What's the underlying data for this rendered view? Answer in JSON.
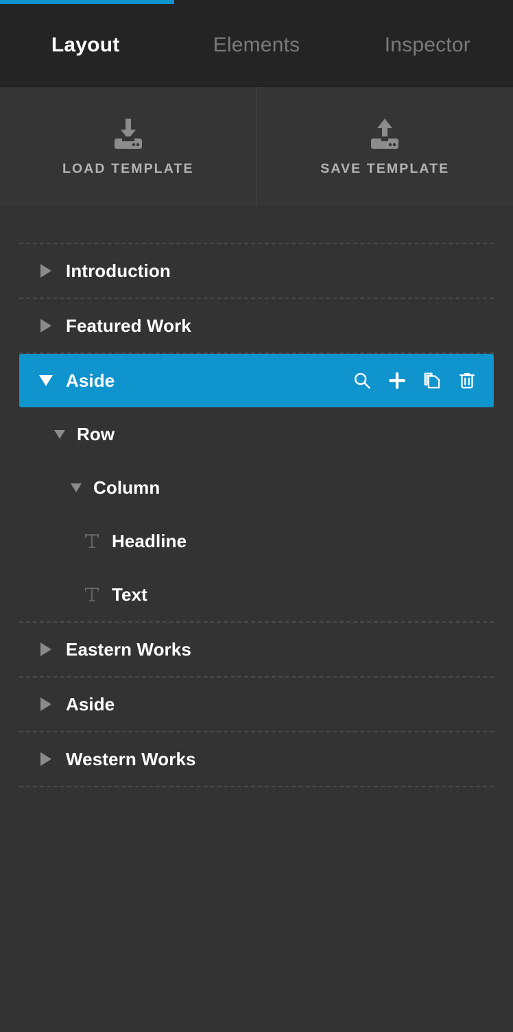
{
  "progress": {
    "percent": 34,
    "color": "#1094ce"
  },
  "tabs": [
    {
      "label": "Layout",
      "active": true
    },
    {
      "label": "Elements",
      "active": false
    },
    {
      "label": "Inspector",
      "active": false
    }
  ],
  "toolbar": {
    "load_label": "LOAD TEMPLATE",
    "load_icon": "download-icon",
    "save_label": "SAVE TEMPLATE",
    "save_icon": "upload-icon"
  },
  "tree": {
    "selected_actions": [
      {
        "name": "search-icon",
        "label": "Search"
      },
      {
        "name": "plus-icon",
        "label": "Add"
      },
      {
        "name": "duplicate-icon",
        "label": "Duplicate"
      },
      {
        "name": "trash-icon",
        "label": "Delete"
      }
    ],
    "items": [
      {
        "label": "Introduction",
        "level": 0,
        "state": "collapsed",
        "icon": "caret-right-icon",
        "selected": false
      },
      {
        "label": "Featured Work",
        "level": 0,
        "state": "collapsed",
        "icon": "caret-right-icon",
        "selected": false
      },
      {
        "label": "Aside",
        "level": 0,
        "state": "expanded",
        "icon": "caret-down-icon",
        "selected": true
      },
      {
        "label": "Row",
        "level": 1,
        "state": "expanded",
        "icon": "caret-down-icon",
        "selected": false
      },
      {
        "label": "Column",
        "level": 2,
        "state": "expanded",
        "icon": "caret-down-icon",
        "selected": false
      },
      {
        "label": "Headline",
        "level": 3,
        "state": "leaf",
        "icon": "text-type-icon",
        "selected": false
      },
      {
        "label": "Text",
        "level": 3,
        "state": "leaf",
        "icon": "text-type-icon",
        "selected": false
      },
      {
        "label": "Eastern Works",
        "level": 0,
        "state": "collapsed",
        "icon": "caret-right-icon",
        "selected": false
      },
      {
        "label": "Aside",
        "level": 0,
        "state": "collapsed",
        "icon": "caret-right-icon",
        "selected": false
      },
      {
        "label": "Western Works",
        "level": 0,
        "state": "collapsed",
        "icon": "caret-right-icon",
        "selected": false
      }
    ]
  },
  "colors": {
    "accent": "#1094ce",
    "panel_bg": "#333333",
    "header_bg": "#242424",
    "toolbar_bg": "#353535",
    "label": "#ffffff",
    "muted": "#7a7a7a",
    "separator": "#4a4a4a"
  }
}
